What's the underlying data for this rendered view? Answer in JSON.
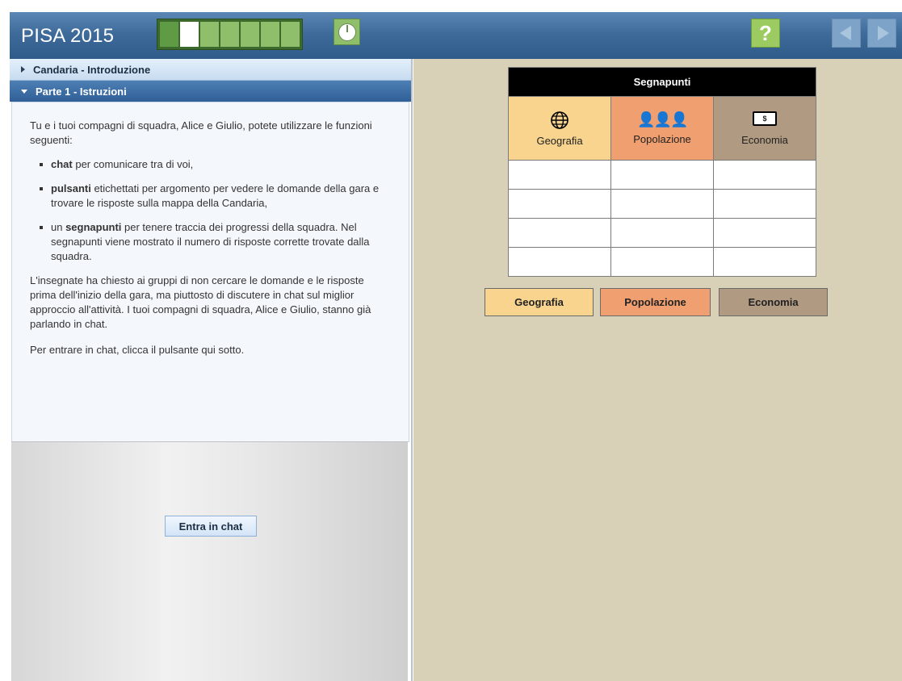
{
  "header": {
    "title": "PISA 2015",
    "progress_segments": 7,
    "progress_done": 1,
    "progress_current": 2,
    "help_label": "?",
    "colors": {
      "header": "#3f6b9b",
      "progress": "#8fbf6a",
      "help": "#9ccb62"
    }
  },
  "left": {
    "section_intro": "Candaria - Introduzione",
    "section_part1": "Parte 1 - Istruzioni",
    "intro": "Tu e i tuoi compagni di squadra, Alice e Giulio, potete utilizzare le funzioni seguenti:",
    "bullets": [
      {
        "bold": "chat",
        "text": " per comunicare tra di voi,"
      },
      {
        "bold": "pulsanti",
        "text": " etichettati per argomento per vedere le domande della gara e trovare le risposte sulla mappa della Candaria,"
      },
      {
        "prefix": "un ",
        "bold": "segnapunti",
        "text": " per tenere traccia dei progressi della squadra. Nel segnapunti viene mostrato il numero di risposte corrette trovate dalla squadra."
      }
    ],
    "para2": "L'insegnate ha chiesto ai gruppi di non cercare le domande e le risposte prima dell'inizio della gara, ma piuttosto di discutere in chat sul miglior approccio all'attività. I tuoi compagni di squadra, Alice e Giulio, stanno già parlando in chat.",
    "para3": "Per entrare in chat, clicca il pulsante qui sotto.",
    "chat_button": "Entra in chat"
  },
  "scoreboard": {
    "title": "Segnapunti",
    "columns": [
      "Geografia",
      "Popolazione",
      "Economia"
    ],
    "rows": 4,
    "money_symbol": "$",
    "colors": {
      "geografia": "#f8d48f",
      "popolazione": "#f0a070",
      "economia": "#b09a82"
    }
  },
  "topics": [
    "Geografia",
    "Popolazione",
    "Economia"
  ]
}
